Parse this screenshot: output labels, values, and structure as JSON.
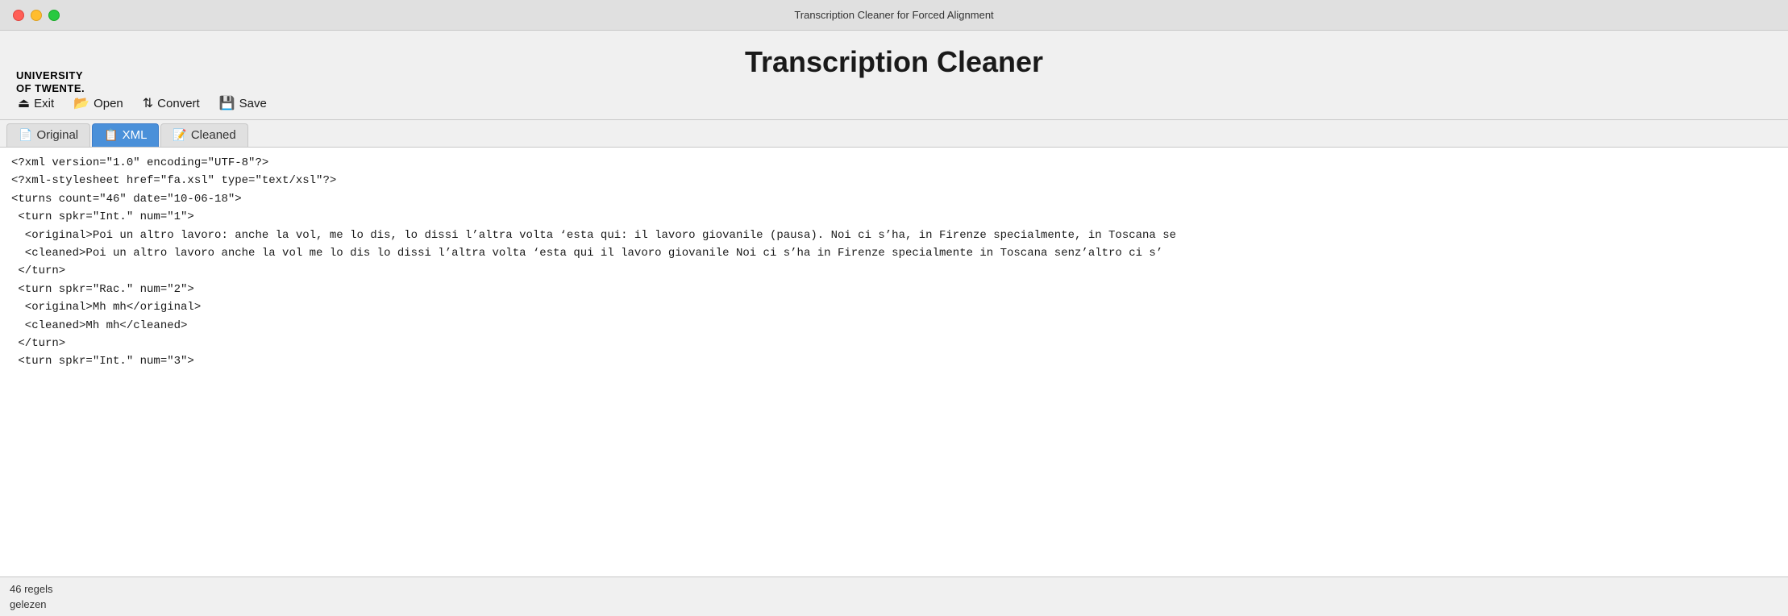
{
  "titleBar": {
    "title": "Transcription Cleaner for Forced Alignment"
  },
  "logo": {
    "line1": "UNIVERSITY",
    "line2": "OF TWENTE."
  },
  "appHeader": {
    "title": "Transcription Cleaner"
  },
  "toolbar": {
    "buttons": [
      {
        "id": "exit",
        "icon": "⏏",
        "label": "Exit"
      },
      {
        "id": "open",
        "icon": "📂",
        "label": "Open"
      },
      {
        "id": "convert",
        "icon": "⇅",
        "label": "Convert"
      },
      {
        "id": "save",
        "icon": "💾",
        "label": "Save"
      }
    ]
  },
  "tabs": [
    {
      "id": "original",
      "icon": "📄",
      "label": "Original",
      "active": false
    },
    {
      "id": "xml",
      "icon": "📋",
      "label": "XML",
      "active": true
    },
    {
      "id": "cleaned",
      "icon": "📝",
      "label": "Cleaned",
      "active": false
    }
  ],
  "content": {
    "lines": [
      "<?xml version=\"1.0\" encoding=\"UTF-8\"?>",
      "<?xml-stylesheet href=\"fa.xsl\" type=\"text/xsl\"?>",
      "<turns count=\"46\" date=\"10-06-18\">",
      " <turn spkr=\"Int.\" num=\"1\">",
      "  <original>Poi un altro lavoro: anche la vol, me lo dis, lo dissi l’altra volta ‘esta qui: il lavoro giovanile (pausa). Noi ci s’ha, in Firenze specialmente, in Toscana se",
      "  <cleaned>Poi un altro lavoro anche la vol me lo dis lo dissi l’altra volta ‘esta qui il lavoro giovanile Noi ci s’ha in Firenze specialmente in Toscana senz’altro ci s’",
      " </turn>",
      " <turn spkr=\"Rac.\" num=\"2\">",
      "  <original>Mh mh</original>",
      "  <cleaned>Mh mh</cleaned>",
      " </turn>",
      " <turn spkr=\"Int.\" num=\"3\">"
    ]
  },
  "statusBar": {
    "line1": "46 regels",
    "line2": "gelezen"
  }
}
